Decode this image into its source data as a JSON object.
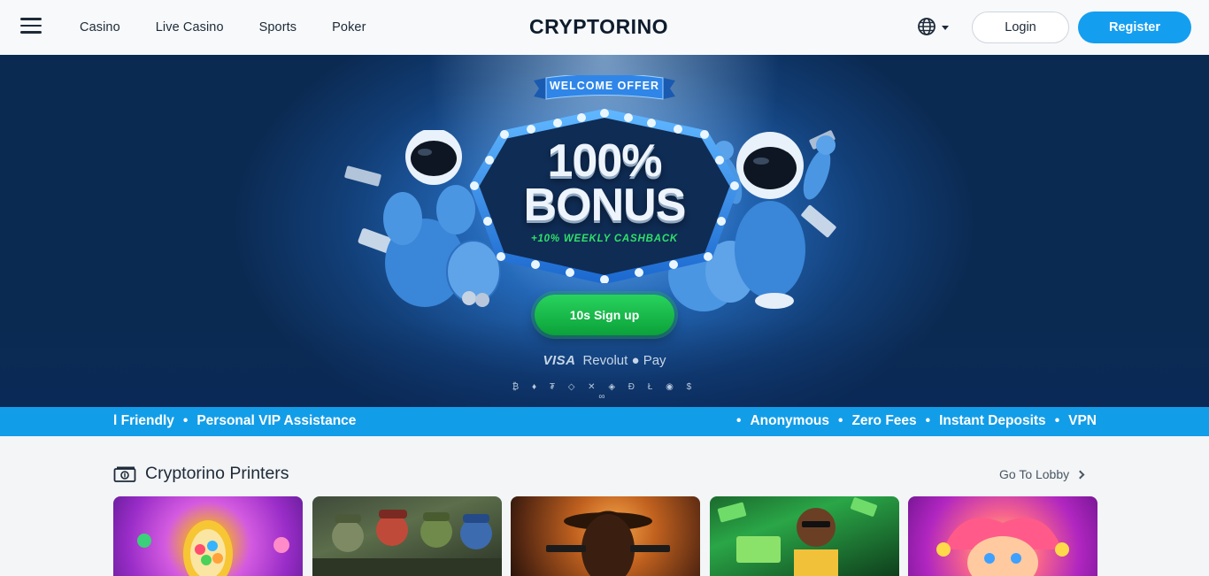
{
  "header": {
    "nav": [
      "Casino",
      "Live Casino",
      "Sports",
      "Poker"
    ],
    "logo": "CRYPTORINO",
    "login_label": "Login",
    "register_label": "Register",
    "icons": {
      "menu": "hamburger-icon",
      "language": "globe-icon"
    }
  },
  "hero": {
    "ribbon": "WELCOME OFFER",
    "headline_line1": "100%",
    "headline_line2": "BONUS",
    "subline": "+10% WEEKLY CASHBACK",
    "cta_label": "10s Sign up",
    "payment_visa": "VISA",
    "payment_revolut": "Revolut",
    "payment_apple": " Pay",
    "crypto_icons": "₿ ♦ ₮ ◇ ✕ ◈ Đ Ł ◉ $ ∞"
  },
  "marquee": {
    "left": [
      "l Friendly",
      "Personal VIP Assistance"
    ],
    "right": [
      "Anonymous",
      "Zero Fees",
      "Instant Deposits",
      "VPN"
    ],
    "bullet": "•"
  },
  "section": {
    "title": "Cryptorino Printers",
    "lobby_label": "Go To Lobby",
    "icon": "money-icon"
  },
  "colors": {
    "accent": "#149ef0",
    "cta": "#19b84a",
    "marquee": "#129de8"
  }
}
